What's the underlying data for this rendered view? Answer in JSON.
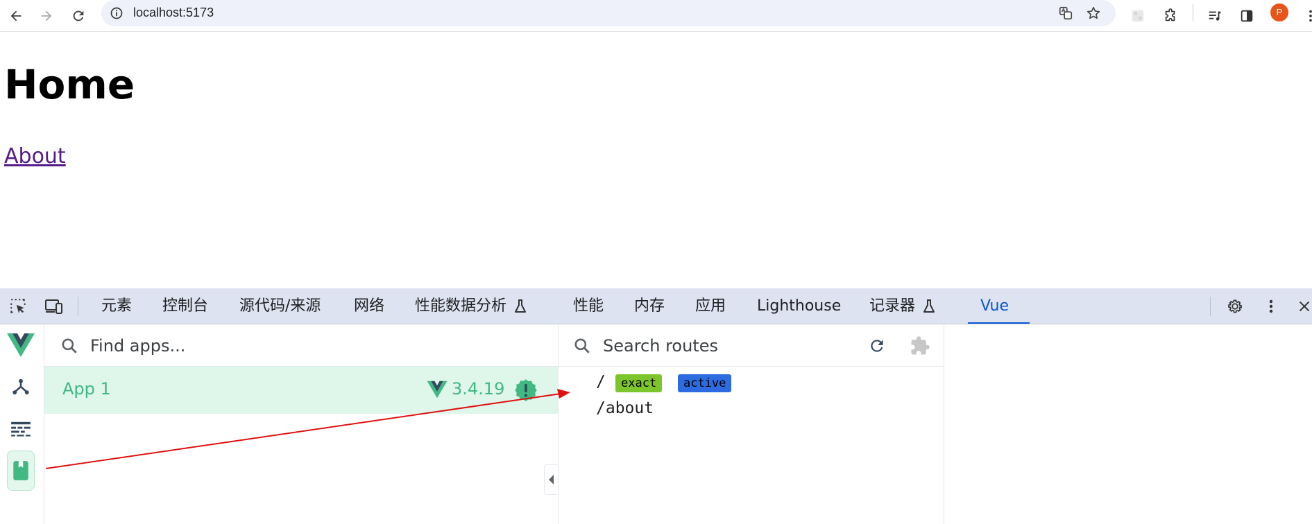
{
  "browser": {
    "url": "localhost:5173",
    "profile_initial": "P"
  },
  "page": {
    "heading": "Home",
    "link": "About"
  },
  "devtools": {
    "tabs": [
      {
        "label": "元素"
      },
      {
        "label": "控制台"
      },
      {
        "label": "源代码/来源"
      },
      {
        "label": "网络"
      },
      {
        "label": "性能数据分析"
      },
      {
        "label": "性能"
      },
      {
        "label": "内存"
      },
      {
        "label": "应用"
      },
      {
        "label": "Lighthouse"
      },
      {
        "label": "记录器"
      },
      {
        "label": "Vue"
      }
    ],
    "active_tab": "Vue"
  },
  "vue": {
    "apps_search_placeholder": "Find apps...",
    "app": {
      "name": "App 1",
      "version": "3.4.19"
    },
    "routes_search_placeholder": "Search routes",
    "routes": [
      {
        "path": "/",
        "tags": [
          "exact",
          "active"
        ]
      },
      {
        "path": "/about",
        "tags": []
      }
    ]
  },
  "colors": {
    "vue_green": "#42b883",
    "tag_exact": "#7cc52b",
    "tag_active": "#2c6be0",
    "annotation_arrow": "#e01010",
    "active_tab": "#0b57d0"
  }
}
